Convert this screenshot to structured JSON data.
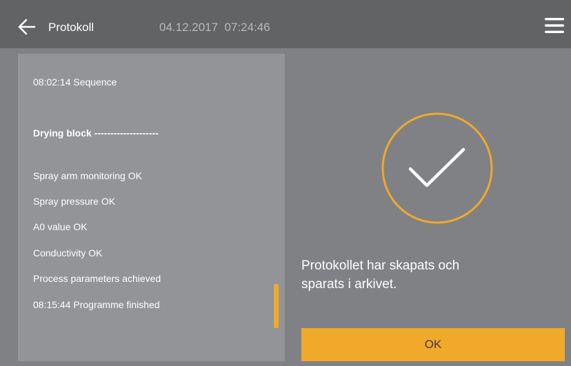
{
  "header": {
    "title": "Protokoll",
    "datetime": "04.12.2017  07:24:46",
    "back_icon": "arrow-left-icon",
    "menu_icon": "hamburger-menu-icon"
  },
  "log": {
    "lines": [
      "08:02:14 Sequence",
      "Drying block --------------------",
      "Spray arm monitoring OK",
      "Spray pressure OK",
      "A0 value OK",
      "Conductivity OK",
      "Process parameters achieved",
      "08:15:44 Programme finished"
    ]
  },
  "status": {
    "icon": "checkmark-circle-icon",
    "message_line1": "Protokollet har skapats och",
    "message_line2": "sparats i arkivet."
  },
  "ok_button": {
    "label": "OK"
  },
  "colors": {
    "header_bg": "#626365",
    "body_bg": "#808184",
    "panel_bg": "#939497",
    "accent": "#f0a92b"
  }
}
